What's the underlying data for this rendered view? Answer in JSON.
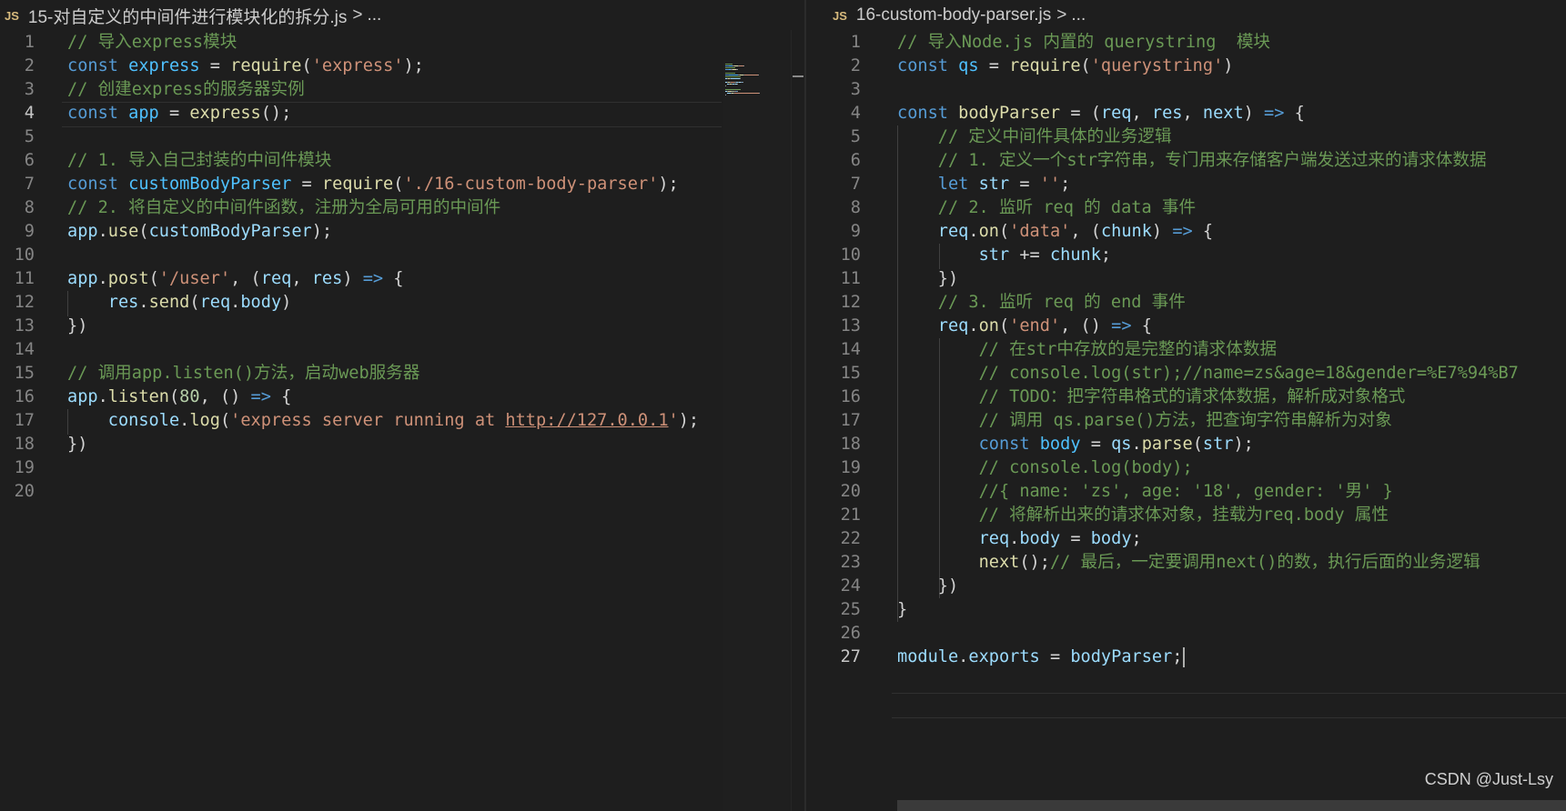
{
  "left_editor": {
    "breadcrumb": {
      "lang_badge": "JS",
      "filename": "15-对自定义的中间件进行模块化的拆分.js",
      "separator": ">",
      "trailing": "..."
    },
    "current_line": 4,
    "lines": [
      [
        [
          "c",
          "// 导入express模块"
        ]
      ],
      [
        [
          "k",
          "const "
        ],
        [
          "cv",
          "express"
        ],
        [
          "p",
          " = "
        ],
        [
          "f",
          "require"
        ],
        [
          "p",
          "("
        ],
        [
          "s",
          "'express'"
        ],
        [
          "p",
          ");"
        ]
      ],
      [
        [
          "c",
          "// 创建express的服务器实例"
        ]
      ],
      [
        [
          "k",
          "const "
        ],
        [
          "cv",
          "app"
        ],
        [
          "p",
          " = "
        ],
        [
          "f",
          "express"
        ],
        [
          "p",
          "();"
        ]
      ],
      [],
      [
        [
          "c",
          "// 1. 导入自己封装的中间件模块"
        ]
      ],
      [
        [
          "k",
          "const "
        ],
        [
          "cv",
          "customBodyParser"
        ],
        [
          "p",
          " = "
        ],
        [
          "f",
          "require"
        ],
        [
          "p",
          "("
        ],
        [
          "s",
          "'./16-custom-body-parser'"
        ],
        [
          "p",
          ");"
        ]
      ],
      [
        [
          "c",
          "// 2. 将自定义的中间件函数，注册为全局可用的中间件"
        ]
      ],
      [
        [
          "v",
          "app"
        ],
        [
          "p",
          "."
        ],
        [
          "f",
          "use"
        ],
        [
          "p",
          "("
        ],
        [
          "v",
          "customBodyParser"
        ],
        [
          "p",
          ");"
        ]
      ],
      [],
      [
        [
          "v",
          "app"
        ],
        [
          "p",
          "."
        ],
        [
          "f",
          "post"
        ],
        [
          "p",
          "("
        ],
        [
          "s",
          "'/user'"
        ],
        [
          "p",
          ", ("
        ],
        [
          "v",
          "req"
        ],
        [
          "p",
          ", "
        ],
        [
          "v",
          "res"
        ],
        [
          "p",
          ") "
        ],
        [
          "k",
          "=>"
        ],
        [
          "p",
          " {"
        ]
      ],
      [
        [
          "p",
          "    "
        ],
        [
          "v",
          "res"
        ],
        [
          "p",
          "."
        ],
        [
          "f",
          "send"
        ],
        [
          "p",
          "("
        ],
        [
          "v",
          "req"
        ],
        [
          "p",
          "."
        ],
        [
          "v",
          "body"
        ],
        [
          "p",
          ")"
        ]
      ],
      [
        [
          "p",
          "})"
        ]
      ],
      [],
      [
        [
          "c",
          "// 调用app.listen()方法，启动web服务器"
        ]
      ],
      [
        [
          "v",
          "app"
        ],
        [
          "p",
          "."
        ],
        [
          "f",
          "listen"
        ],
        [
          "p",
          "("
        ],
        [
          "n",
          "80"
        ],
        [
          "p",
          ", () "
        ],
        [
          "k",
          "=>"
        ],
        [
          "p",
          " {"
        ]
      ],
      [
        [
          "p",
          "    "
        ],
        [
          "v",
          "console"
        ],
        [
          "p",
          "."
        ],
        [
          "f",
          "log"
        ],
        [
          "p",
          "("
        ],
        [
          "s",
          "'express server running at "
        ],
        [
          "sl",
          "http://127.0.0.1"
        ],
        [
          "s",
          "'"
        ],
        [
          "p",
          ");"
        ]
      ],
      [
        [
          "p",
          "})"
        ]
      ],
      [],
      []
    ]
  },
  "right_editor": {
    "breadcrumb": {
      "lang_badge": "JS",
      "filename": "16-custom-body-parser.js",
      "separator": ">",
      "trailing": "..."
    },
    "current_line": 27,
    "lines": [
      [
        [
          "c",
          "// 导入Node.js 内置的 querystring  模块"
        ]
      ],
      [
        [
          "k",
          "const "
        ],
        [
          "cv",
          "qs"
        ],
        [
          "p",
          " = "
        ],
        [
          "f",
          "require"
        ],
        [
          "p",
          "("
        ],
        [
          "s",
          "'querystring'"
        ],
        [
          "p",
          ")"
        ]
      ],
      [],
      [
        [
          "k",
          "const "
        ],
        [
          "f",
          "bodyParser"
        ],
        [
          "p",
          " = ("
        ],
        [
          "v",
          "req"
        ],
        [
          "p",
          ", "
        ],
        [
          "v",
          "res"
        ],
        [
          "p",
          ", "
        ],
        [
          "v",
          "next"
        ],
        [
          "p",
          ") "
        ],
        [
          "k",
          "=>"
        ],
        [
          "p",
          " {"
        ]
      ],
      [
        [
          "p",
          "    "
        ],
        [
          "c",
          "// 定义中间件具体的业务逻辑"
        ]
      ],
      [
        [
          "p",
          "    "
        ],
        [
          "c",
          "// 1. 定义一个str字符串，专门用来存储客户端发送过来的请求体数据"
        ]
      ],
      [
        [
          "p",
          "    "
        ],
        [
          "k",
          "let "
        ],
        [
          "v",
          "str"
        ],
        [
          "p",
          " = "
        ],
        [
          "s",
          "''"
        ],
        [
          "p",
          ";"
        ]
      ],
      [
        [
          "p",
          "    "
        ],
        [
          "c",
          "// 2. 监听 req 的 data 事件"
        ]
      ],
      [
        [
          "p",
          "    "
        ],
        [
          "v",
          "req"
        ],
        [
          "p",
          "."
        ],
        [
          "f",
          "on"
        ],
        [
          "p",
          "("
        ],
        [
          "s",
          "'data'"
        ],
        [
          "p",
          ", ("
        ],
        [
          "v",
          "chunk"
        ],
        [
          "p",
          ") "
        ],
        [
          "k",
          "=>"
        ],
        [
          "p",
          " {"
        ]
      ],
      [
        [
          "p",
          "        "
        ],
        [
          "v",
          "str"
        ],
        [
          "p",
          " += "
        ],
        [
          "v",
          "chunk"
        ],
        [
          "p",
          ";"
        ]
      ],
      [
        [
          "p",
          "    })"
        ]
      ],
      [
        [
          "p",
          "    "
        ],
        [
          "c",
          "// 3. 监听 req 的 end 事件"
        ]
      ],
      [
        [
          "p",
          "    "
        ],
        [
          "v",
          "req"
        ],
        [
          "p",
          "."
        ],
        [
          "f",
          "on"
        ],
        [
          "p",
          "("
        ],
        [
          "s",
          "'end'"
        ],
        [
          "p",
          ", () "
        ],
        [
          "k",
          "=>"
        ],
        [
          "p",
          " {"
        ]
      ],
      [
        [
          "p",
          "        "
        ],
        [
          "c",
          "// 在str中存放的是完整的请求体数据"
        ]
      ],
      [
        [
          "p",
          "        "
        ],
        [
          "c",
          "// console.log(str);//name=zs&age=18&gender=%E7%94%B7"
        ]
      ],
      [
        [
          "p",
          "        "
        ],
        [
          "c",
          "// TODO：把字符串格式的请求体数据，解析成对象格式"
        ]
      ],
      [
        [
          "p",
          "        "
        ],
        [
          "c",
          "// 调用 qs.parse()方法，把查询字符串解析为对象"
        ]
      ],
      [
        [
          "p",
          "        "
        ],
        [
          "k",
          "const "
        ],
        [
          "cv",
          "body"
        ],
        [
          "p",
          " = "
        ],
        [
          "v",
          "qs"
        ],
        [
          "p",
          "."
        ],
        [
          "f",
          "parse"
        ],
        [
          "p",
          "("
        ],
        [
          "v",
          "str"
        ],
        [
          "p",
          ");"
        ]
      ],
      [
        [
          "p",
          "        "
        ],
        [
          "c",
          "// console.log(body);"
        ]
      ],
      [
        [
          "p",
          "        "
        ],
        [
          "c",
          "//{ name: 'zs', age: '18', gender: '男' }"
        ]
      ],
      [
        [
          "p",
          "        "
        ],
        [
          "c",
          "// 将解析出来的请求体对象，挂载为req.body 属性"
        ]
      ],
      [
        [
          "p",
          "        "
        ],
        [
          "v",
          "req"
        ],
        [
          "p",
          "."
        ],
        [
          "v",
          "body"
        ],
        [
          "p",
          " = "
        ],
        [
          "v",
          "body"
        ],
        [
          "p",
          ";"
        ]
      ],
      [
        [
          "p",
          "        "
        ],
        [
          "f",
          "next"
        ],
        [
          "p",
          "();"
        ],
        [
          "c",
          "// 最后，一定要调用next()的数，执行后面的业务逻辑"
        ]
      ],
      [
        [
          "p",
          "    })"
        ]
      ],
      [
        [
          "p",
          "}"
        ]
      ],
      [],
      [
        [
          "v",
          "module"
        ],
        [
          "p",
          "."
        ],
        [
          "v",
          "exports"
        ],
        [
          "p",
          " = "
        ],
        [
          "v",
          "bodyParser"
        ],
        [
          "p",
          ";"
        ]
      ]
    ]
  },
  "watermark": "CSDN @Just-Lsy"
}
